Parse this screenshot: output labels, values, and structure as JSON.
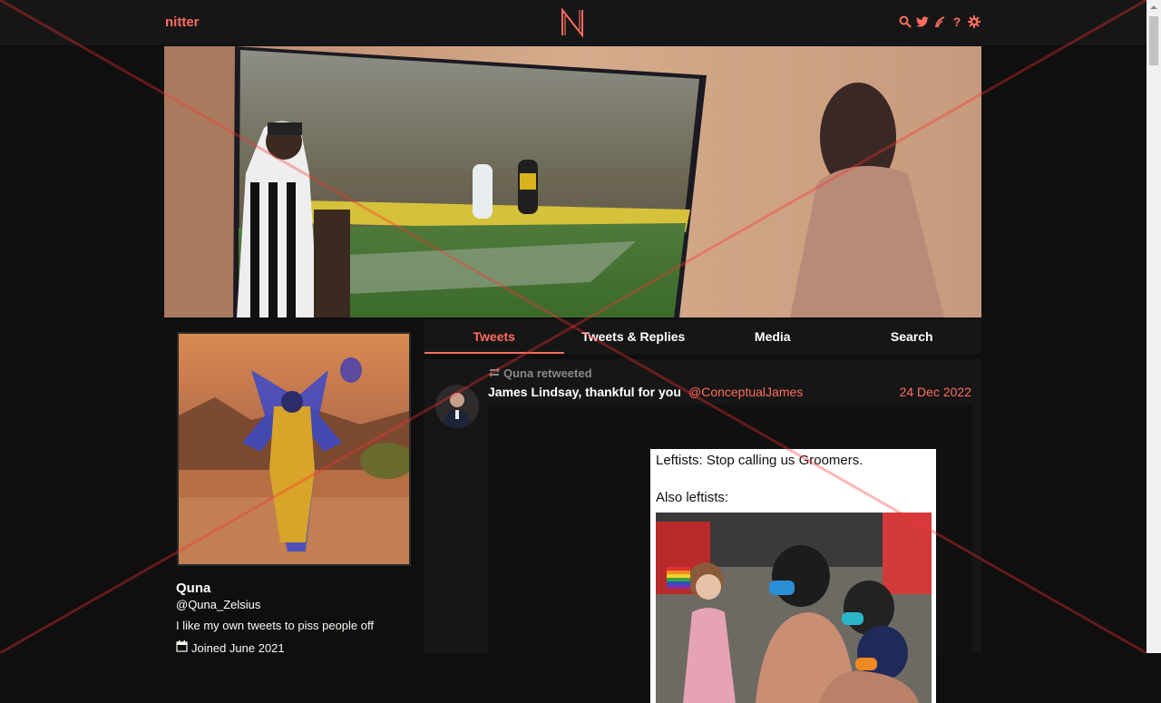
{
  "nav": {
    "brand": "nitter",
    "logo_letter": "N",
    "icons": [
      "search-icon",
      "twitter-bird-icon",
      "rss-icon",
      "help-icon",
      "settings-gear-icon"
    ],
    "help_glyph": "?"
  },
  "profile": {
    "fullname": "Quna",
    "username": "@Quna_Zelsius",
    "bio": "I like my own tweets to piss people off",
    "joined": "Joined June 2021"
  },
  "tabs": [
    {
      "label": "Tweets",
      "active": true
    },
    {
      "label": "Tweets & Replies",
      "active": false
    },
    {
      "label": "Media",
      "active": false
    },
    {
      "label": "Search",
      "active": false
    }
  ],
  "tweet": {
    "retweet_header": "Quna retweeted",
    "fullname": "James Lindsay, thankful for you",
    "username": "@ConceptualJames",
    "date": "24 Dec 2022",
    "meme_line1": "Leftists: Stop calling us Groomers.",
    "meme_line2": "Also leftists:"
  },
  "colors": {
    "accent": "#ff6c60",
    "background": "#0f0f0f",
    "panel": "#161616",
    "overlay_x": "#ff3030"
  }
}
